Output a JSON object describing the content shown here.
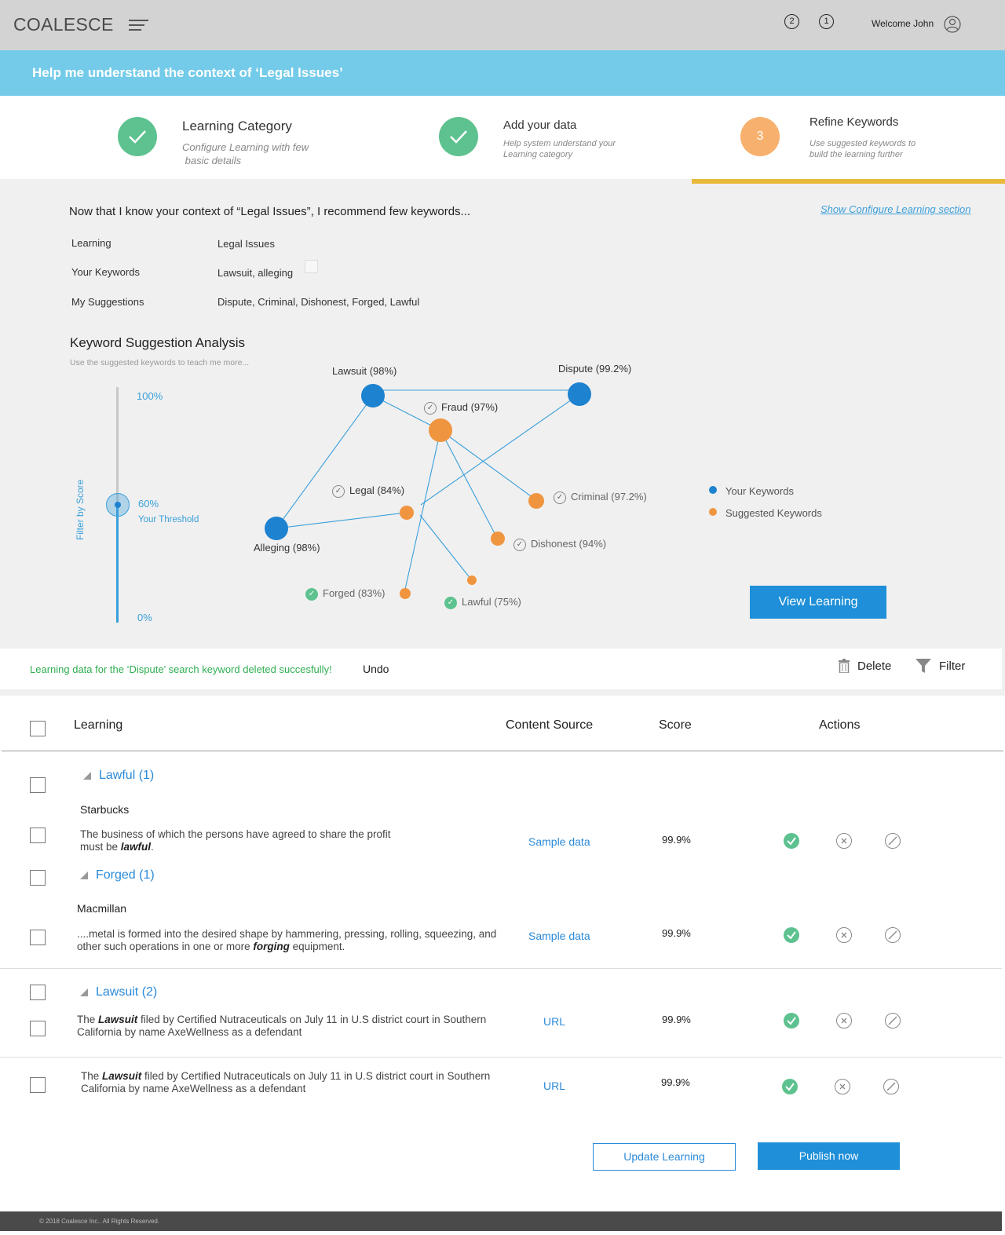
{
  "header": {
    "logo": "COALESCE",
    "notifications": [
      "2",
      "1"
    ],
    "welcome": "Welcome John"
  },
  "banner": {
    "title": "Help me understand the context of ‘Legal Issues’"
  },
  "steps": [
    {
      "title": "Learning Category",
      "desc_1": "Configure Learning with few",
      "desc_2": " basic details",
      "state": "done"
    },
    {
      "title": "Add your data",
      "desc_1": "Help system understand your",
      "desc_2": "Learning category",
      "state": "done"
    },
    {
      "number": "3",
      "title": "Refine Keywords",
      "desc_1": "Use suggested keywords to",
      "desc_2": "build the learning further",
      "state": "active"
    }
  ],
  "context": {
    "intro": "Now that I know your context of “Legal Issues”, I recommend few keywords...",
    "show_config_link": "Show Configure Learning section",
    "rows": [
      {
        "label": "Learning",
        "value": "Legal Issues"
      },
      {
        "label": "Your Keywords",
        "value": "Lawsuit, alleging"
      },
      {
        "label": "My Suggestions",
        "value": "Dispute, Criminal, Dishonest, Forged, Lawful"
      }
    ]
  },
  "analysis": {
    "title": "Keyword Suggestion Analysis",
    "subtitle": "Use the suggested keywords to teach me more...",
    "slider": {
      "max_label": "100%",
      "min_label": "0%",
      "value_label": "60%",
      "threshold_label": "Your Threshold",
      "axis_label": "Filter by Score",
      "value": 0.6
    },
    "nodes": {
      "lawsuit": "Lawsuit (98%)",
      "dispute": "Dispute (99.2%)",
      "fraud": "Fraud (97%)",
      "legal": "Legal (84%)",
      "criminal": "Criminal (97.2%)",
      "alleging": "Alleging (98%)",
      "dishonest": "Dishonest (94%)",
      "forged": "Forged (83%)",
      "lawful": "Lawful (75%)"
    },
    "legend": [
      {
        "label": "Your Keywords",
        "color": "#1d82cf"
      },
      {
        "label": "Suggested Keywords",
        "color": "#f0953f"
      }
    ],
    "view_learning": "View Learning"
  },
  "notice": {
    "message": "Learning data for the ‘Dispute’ search keyword deleted succesfully!",
    "undo": "Undo",
    "delete": "Delete",
    "filter": "Filter"
  },
  "table": {
    "headers": {
      "learning": "Learning",
      "source": "Content Source",
      "score": "Score",
      "actions": "Actions"
    },
    "groups": {
      "lawful": "Lawful (1)",
      "forged": "Forged (1)",
      "lawsuit": "Lawsuit (2)"
    },
    "rows": [
      {
        "source_name": "Starbucks",
        "pre": " The business of which the persons have agreed to share the profit must be ",
        "kw": "lawful",
        "post": ".",
        "content_source": "Sample data",
        "score": "99.9%"
      },
      {
        "source_name": "Macmillan",
        "pre": "....metal is formed into the desired shape by hammering, pressing, rolling, squeezing, and other such operations in one or more ",
        "kw": "forging",
        "post": " equipment.",
        "content_source": "Sample data",
        "score": "99.9%"
      },
      {
        "pre": "The ",
        "kw": "Lawsuit",
        "post": " filed by Certified Nutraceuticals on July 11 in U.S district court in Southern California by name AxeWellness as a defendant",
        "content_source": "URL",
        "score": "99.9%"
      },
      {
        "pre": "The ",
        "kw": "Lawsuit",
        "post": " filed by Certified Nutraceuticals on July 11 in U.S district court in Southern California by name AxeWellness as a defendant",
        "content_source": "URL",
        "score": "99.9%"
      }
    ]
  },
  "buttons": {
    "update": "Update Learning",
    "publish": "Publish now"
  },
  "footer": {
    "text": "© 2018 Coalesce Inc.. All Rights Reserved."
  }
}
